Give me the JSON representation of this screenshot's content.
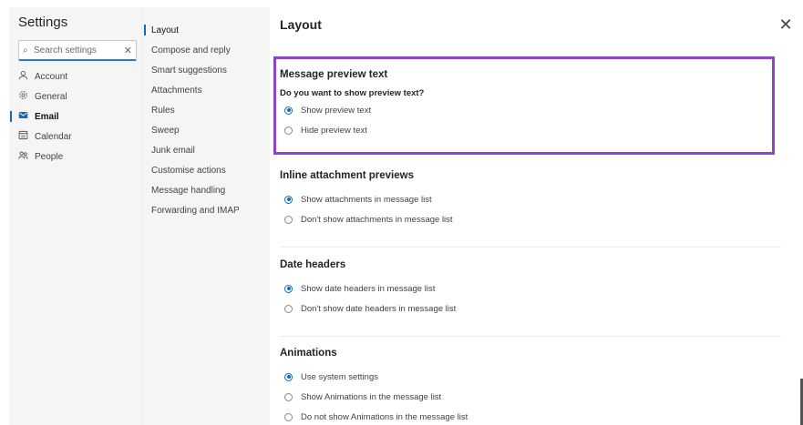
{
  "nav": {
    "title": "Settings",
    "search": {
      "placeholder": "Search settings",
      "value": ""
    },
    "items": [
      {
        "label": "Account",
        "icon": "person-icon"
      },
      {
        "label": "General",
        "icon": "gear-icon"
      },
      {
        "label": "Email",
        "icon": "mail-icon",
        "active": true
      },
      {
        "label": "Calendar",
        "icon": "calendar-icon"
      },
      {
        "label": "People",
        "icon": "people-icon"
      }
    ]
  },
  "subnav": {
    "items": [
      {
        "label": "Layout",
        "active": true
      },
      {
        "label": "Compose and reply"
      },
      {
        "label": "Smart suggestions"
      },
      {
        "label": "Attachments"
      },
      {
        "label": "Rules"
      },
      {
        "label": "Sweep"
      },
      {
        "label": "Junk email"
      },
      {
        "label": "Customise actions"
      },
      {
        "label": "Message handling"
      },
      {
        "label": "Forwarding and IMAP"
      }
    ]
  },
  "content": {
    "title": "Layout",
    "sections": {
      "preview": {
        "heading": "Message preview text",
        "question": "Do you want to show preview text?",
        "options": [
          "Show preview text",
          "Hide preview text"
        ],
        "selected": 0
      },
      "inline": {
        "heading": "Inline attachment previews",
        "options": [
          "Show attachments in message list",
          "Don't show attachments in message list"
        ],
        "selected": 0
      },
      "dates": {
        "heading": "Date headers",
        "options": [
          "Show date headers in message list",
          "Don't show date headers in message list"
        ],
        "selected": 0
      },
      "animations": {
        "heading": "Animations",
        "options": [
          "Use system settings",
          "Show Animations in the message list",
          "Do not show Animations in the message list"
        ],
        "selected": 0
      }
    }
  },
  "colors": {
    "accent": "#0f6cbd",
    "highlight": "#8e44c9",
    "sidebar": "#f5f5f5"
  }
}
